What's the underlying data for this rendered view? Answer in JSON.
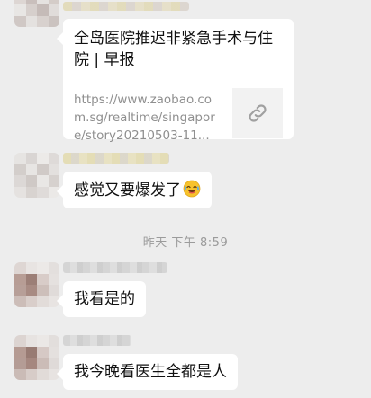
{
  "colors": {
    "background": "#ededed",
    "bubble": "#ffffff",
    "text": "#111111",
    "muted": "#8f8f8f",
    "timestamp": "#9b9b9b"
  },
  "messages": [
    {
      "type": "link",
      "title": "全岛医院推迟非紧急手术与住院 | 早报",
      "url": "https://www.zaobao.com.sg/realtime/singapore/story20210503-11...",
      "thumb_icon": "link-icon"
    },
    {
      "type": "text",
      "text": "感觉又要爆发了",
      "emoji": "laughing-crying-face-icon"
    }
  ],
  "timestamp": "昨天 下午 8:59",
  "messages_after": [
    {
      "type": "text",
      "text": "我看是的"
    },
    {
      "type": "text",
      "text": "我今晚看医生全都是人"
    }
  ]
}
